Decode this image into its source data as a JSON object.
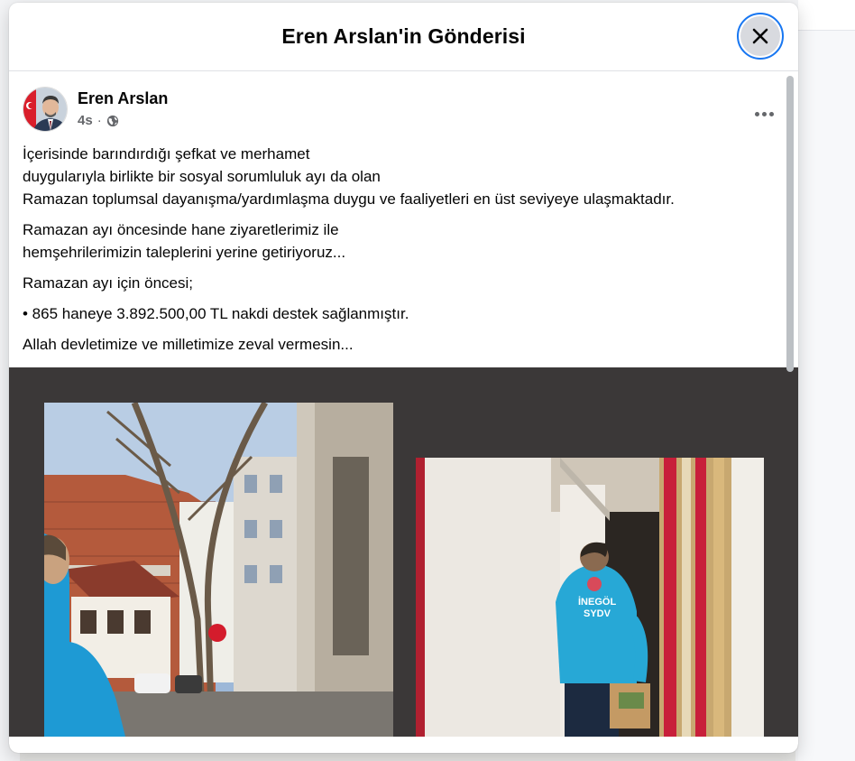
{
  "dialog": {
    "title": "Eren Arslan'in Gönderisi"
  },
  "post": {
    "author": "Eren Arslan",
    "time": "4s",
    "privacy_icon": "globe-icon",
    "paragraphs": [
      "İçerisinde barındırdığı şefkat ve merhamet\nduygularıyla birlikte bir sosyal sorumluluk ayı da olan\nRamazan toplumsal dayanışma/yardımlaşma duygu ve faaliyetleri en üst seviyeye ulaşmaktadır.",
      "Ramazan ayı öncesinde hane ziyaretlerimiz ile\nhemşehrilerimizin taleplerini yerine getiriyoruz...",
      "Ramazan ayı için öncesi;",
      "• 865 haneye 3.892.500,00 TL nakdi destek sağlanmıştır.",
      "Allah devletimize ve milletimize zeval vermesin..."
    ]
  },
  "photos": {
    "jacket_text": [
      "İNEGÖL",
      "SYDV"
    ]
  },
  "colors": {
    "accent": "#1877f2",
    "photo_bg": "#3b3838",
    "text_primary": "#050505",
    "text_secondary": "#65676b"
  },
  "icons": [
    "close-icon",
    "globe-icon",
    "more-icon"
  ]
}
